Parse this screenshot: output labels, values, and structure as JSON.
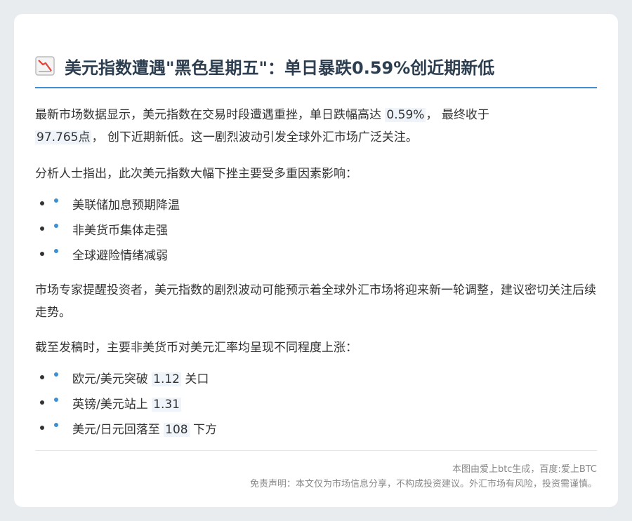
{
  "header": {
    "icon": "chart-decreasing-icon",
    "title": "美元指数遭遇\"黑色星期五\"：单日暴跌0.59%创近期新低"
  },
  "intro": {
    "part1": "最新市场数据显示，美元指数在交易时段遭遇重挫，单日跌幅高达",
    "drop_pct": "0.59%",
    "part2": "，  最终收于",
    "close_value": "97.765点",
    "part3": "，  创下近期新低。这一剧烈波动引发全球外汇市场广泛关注。"
  },
  "analysis": {
    "lead": "分析人士指出，此次美元指数大幅下挫主要受多重因素影响：",
    "factors": [
      "美联储加息预期降温",
      "非美货币集体走强",
      "全球避险情绪减弱"
    ]
  },
  "advice": "市场专家提醒投资者，美元指数的剧烈波动可能预示着全球外汇市场将迎来新一轮调整，建议密切关注后续走势。",
  "currencies": {
    "lead": "截至发稿时，主要非美货币对美元汇率均呈现不同程度上涨：",
    "items": [
      {
        "pre": "欧元/美元突破",
        "value": "1.12",
        "post": "关口"
      },
      {
        "pre": "英镑/美元站上",
        "value": "1.31",
        "post": ""
      },
      {
        "pre": "美元/日元回落至",
        "value": "108",
        "post": "下方"
      }
    ]
  },
  "footer": {
    "source": "本图由爱上btc生成，百度:爱上BTC",
    "disclaimer": "免责声明：本文仅为市场信息分享，不构成投资建议。外汇市场有风险，投资需谨慎。"
  },
  "colors": {
    "accent": "#3b8fd4",
    "title": "#2c3e50",
    "highlight_bg": "#eef4fa"
  }
}
